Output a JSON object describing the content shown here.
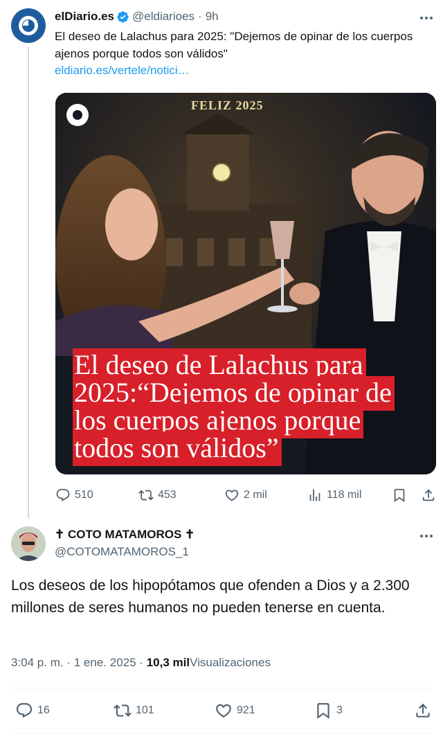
{
  "tweet1": {
    "author_name": "elDiario.es",
    "handle": "@eldiarioes",
    "separator": "·",
    "time": "9h",
    "text": "El deseo de Lalachus para 2025: \"Dejemos de opinar de los cuerpos ajenos porque todos son válidos\"",
    "link": "eldiario.es/vertele/notici…",
    "media": {
      "overlay_top": "FELIZ 2025",
      "headline": "El deseo de Lalachus para 2025:“Dejemos de opinar de los cuerpos ajenos porque todos son válidos”"
    },
    "actions": {
      "replies": "510",
      "reposts": "453",
      "likes": "2 mil",
      "views": "118 mil"
    }
  },
  "tweet2": {
    "author_name": "✝ COTO MATAMOROS ✝",
    "handle": "@COTOMATAMOROS_1",
    "text": "Los deseos de los hipopótamos que ofenden a Dios y a 2.300 millones de seres humanos no pueden tenerse en cuenta.",
    "time": "3:04 p. m.",
    "date_separator": "·",
    "date": "1 ene. 2025",
    "views_separator": "·",
    "views_count": "10,3 mil",
    "views_label": "Visualizaciones",
    "actions": {
      "replies": "16",
      "reposts": "101",
      "likes": "921",
      "bookmarks": "3"
    }
  },
  "colors": {
    "text": "#0f1419",
    "secondary": "#536471",
    "link": "#1d9bf0",
    "verified": "#1d9bf0",
    "headline_bg": "#d7202a"
  }
}
